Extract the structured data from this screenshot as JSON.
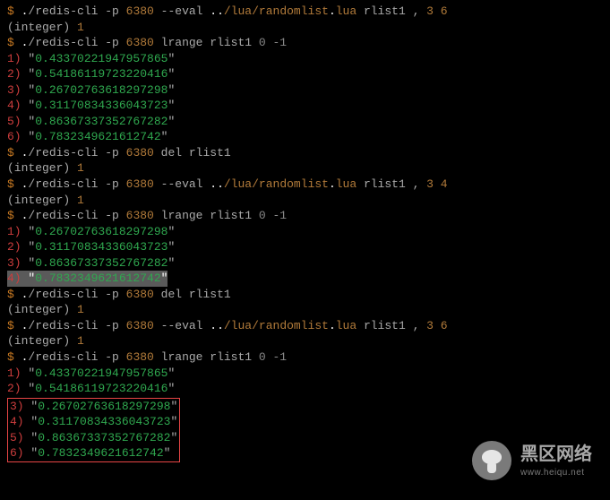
{
  "blocks": [
    {
      "cmd": {
        "prefix": "$ ",
        "exe": "./redis-cli -p ",
        "port": "6380",
        "rest": " --eval ",
        "path": "../lua/randomlist.lua",
        "tail1": " rlist1 , ",
        "args": "3 6"
      },
      "result_int": "(integer) 1"
    },
    {
      "cmd": {
        "prefix": "$ ",
        "exe": "./redis-cli -p ",
        "port": "6380",
        "rest": " lrange rlist1 ",
        "range": "0 -1"
      },
      "list": [
        "0.43370221947957865",
        "0.54186119723220416",
        "0.26702763618297298",
        "0.31170834336043723",
        "0.86367337352767282",
        "0.7832349621612742"
      ]
    },
    {
      "cmd": {
        "prefix": "$ ",
        "exe": "./redis-cli -p ",
        "port": "6380",
        "rest": " del rlist1"
      },
      "result_int": "(integer) 1"
    },
    {
      "cmd": {
        "prefix": "$ ",
        "exe": "./redis-cli -p ",
        "port": "6380",
        "rest": " --eval ",
        "path": "../lua/randomlist.lua",
        "tail1": " rlist1 , ",
        "args": "3 4"
      },
      "result_int": "(integer) 1"
    },
    {
      "cmd": {
        "prefix": "$ ",
        "exe": "./redis-cli -p ",
        "port": "6380",
        "rest": " lrange rlist1 ",
        "range": "0 -1"
      },
      "list": [
        "0.26702763618297298",
        "0.31170834336043723",
        "0.86367337352767282",
        "0.7832349621612742"
      ],
      "highlight_last": true
    },
    {
      "cmd": {
        "prefix": "$ ",
        "exe": "./redis-cli -p ",
        "port": "6380",
        "rest": " del rlist1"
      },
      "result_int": "(integer) 1"
    },
    {
      "cmd": {
        "prefix": "$ ",
        "exe": "./redis-cli -p ",
        "port": "6380",
        "rest": " --eval ",
        "path": "../lua/randomlist.lua",
        "tail1": " rlist1 , ",
        "args": "3 6"
      },
      "result_int": "(integer) 1"
    },
    {
      "cmd": {
        "prefix": "$ ",
        "exe": "./redis-cli -p ",
        "port": "6380",
        "rest": " lrange rlist1 ",
        "range": "0 -1"
      },
      "list_top": [
        "0.43370221947957865",
        "0.54186119723220416"
      ],
      "list_boxed": [
        "0.26702763618297298",
        "0.31170834336043723",
        "0.86367337352767282",
        "0.7832349621612742"
      ]
    }
  ],
  "watermark": {
    "cn": "黑区网络",
    "en": "www.heiqu.net"
  }
}
